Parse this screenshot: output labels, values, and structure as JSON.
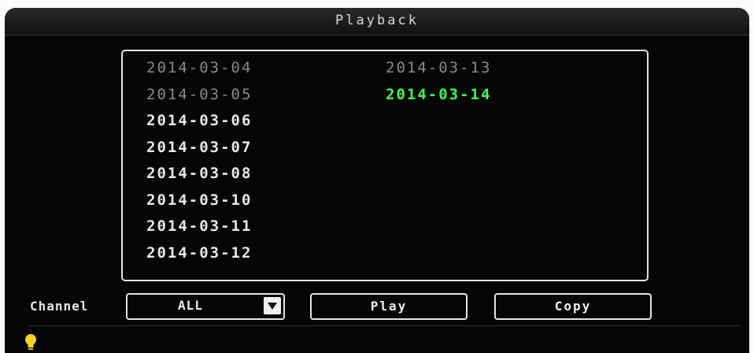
{
  "window": {
    "title": "Playback"
  },
  "dates": {
    "left": [
      {
        "label": "2014-03-04",
        "state": "dim"
      },
      {
        "label": "2014-03-05",
        "state": "dim"
      },
      {
        "label": "2014-03-06",
        "state": "normal"
      },
      {
        "label": "2014-03-07",
        "state": "normal"
      },
      {
        "label": "2014-03-08",
        "state": "normal"
      },
      {
        "label": "2014-03-10",
        "state": "normal"
      },
      {
        "label": "2014-03-11",
        "state": "normal"
      },
      {
        "label": "2014-03-12",
        "state": "normal"
      }
    ],
    "right": [
      {
        "label": "2014-03-13",
        "state": "dim"
      },
      {
        "label": "2014-03-14",
        "state": "selected"
      }
    ]
  },
  "controls": {
    "channel_label": "Channel",
    "channel_value": "ALL",
    "play_label": "Play",
    "copy_label": "Copy"
  },
  "colors": {
    "selected": "#39ff4a",
    "text": "#e8e8e8",
    "dim_text": "#8a8a8a",
    "background": "#050505"
  },
  "icons": {
    "status": "lightbulb-icon",
    "dropdown": "triangle-down-icon"
  }
}
